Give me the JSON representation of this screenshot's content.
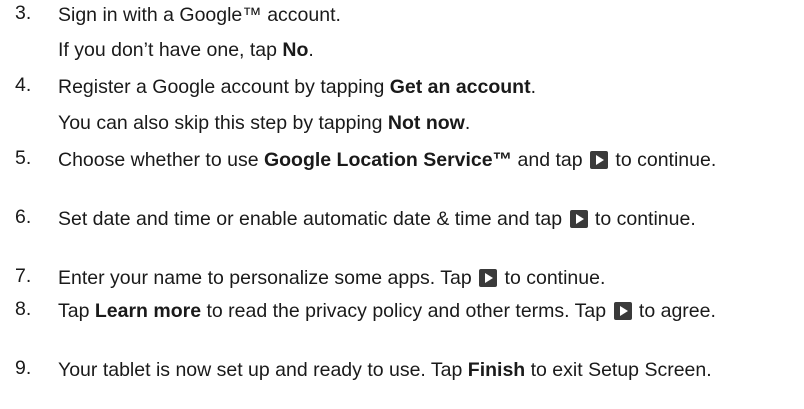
{
  "icon": "play-arrow-icon",
  "steps": [
    {
      "number": "3.",
      "text": [
        {
          "t": "Sign in with a Google™ account."
        }
      ],
      "note": [
        {
          "t": "If you don’t have one, tap "
        },
        {
          "t": "No",
          "b": true
        },
        {
          "t": "."
        }
      ]
    },
    {
      "number": "4.",
      "text": [
        {
          "t": "Register a Google account by tapping "
        },
        {
          "t": "Get an account",
          "b": true
        },
        {
          "t": "."
        }
      ],
      "note": [
        {
          "t": "You can also skip this step by tapping "
        },
        {
          "t": "Not now",
          "b": true
        },
        {
          "t": "."
        }
      ]
    },
    {
      "number": "5.",
      "text": [
        {
          "t": "Choose whether to use "
        },
        {
          "t": "Google Location Service™",
          "b": true
        },
        {
          "t": " and tap "
        },
        {
          "icon": "play-arrow-icon"
        },
        {
          "t": " to continue."
        }
      ]
    },
    {
      "number": "6.",
      "text": [
        {
          "t": "Set date and time or enable automatic date & time and tap "
        },
        {
          "icon": "play-arrow-icon"
        },
        {
          "t": " to continue."
        }
      ]
    },
    {
      "number": "7.",
      "text": [
        {
          "t": "Enter your name to personalize some apps. Tap "
        },
        {
          "icon": "play-arrow-icon"
        },
        {
          "t": " to continue."
        }
      ]
    },
    {
      "number": "8.",
      "text": [
        {
          "t": "Tap "
        },
        {
          "t": "Learn more",
          "b": true
        },
        {
          "t": " to read the privacy policy and other terms. Tap "
        },
        {
          "icon": "play-arrow-icon"
        },
        {
          "t": " to agree."
        }
      ]
    },
    {
      "number": "9.",
      "text": [
        {
          "t": "Your tablet is now set up and ready to use. Tap "
        },
        {
          "t": "Finish",
          "b": true
        },
        {
          "t": " to exit Setup Screen."
        }
      ]
    }
  ]
}
